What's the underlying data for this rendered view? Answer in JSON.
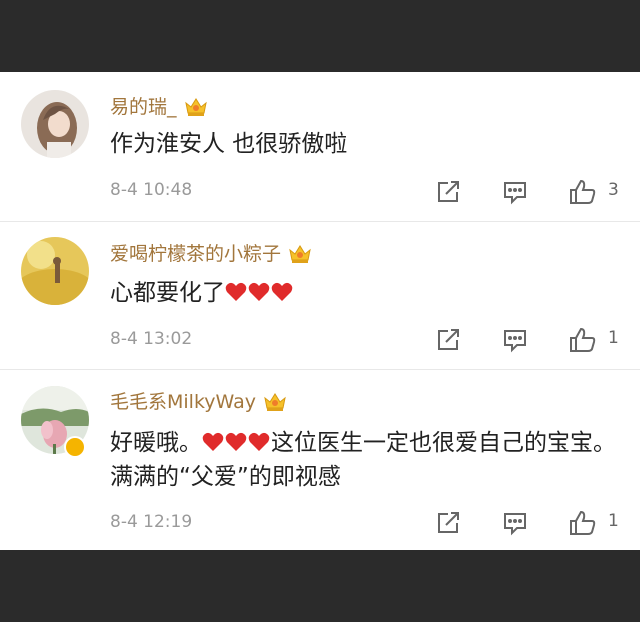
{
  "comments": [
    {
      "username": "易的瑞_",
      "text": "作为淮安人  也很骄傲啦",
      "time": "8-4 10:48",
      "likes": "3",
      "hearts": 0,
      "verified": false
    },
    {
      "username": "爱喝柠檬茶的小粽子",
      "text": "心都要化了",
      "time": "8-4 13:02",
      "likes": "1",
      "hearts": 3,
      "verified": false
    },
    {
      "username": "毛毛系MilkyWay",
      "text_before": "好暖哦。",
      "text_after": "这位医生一定也很爱自己的宝宝。满满的“父爱”的即视感",
      "time": "8-4 12:19",
      "likes": "1",
      "hearts": 3,
      "verified": true
    }
  ],
  "colors": {
    "username": "#a2763c",
    "heart": "#e02b2b",
    "time": "#9a9a9a",
    "frame": "#2b2b2b"
  },
  "icons": [
    "crown-badge-icon",
    "share-icon",
    "reply-icon",
    "like-icon",
    "heart-icon",
    "verified-icon"
  ]
}
